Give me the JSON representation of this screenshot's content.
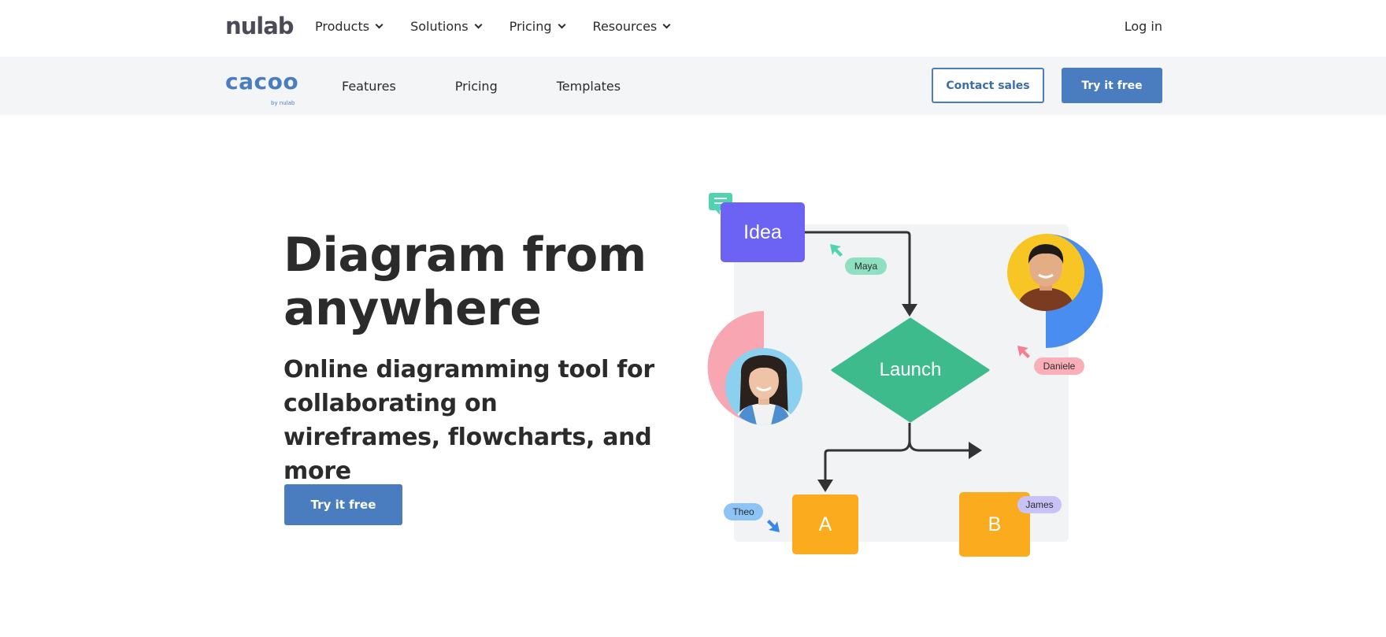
{
  "topnav": {
    "logo": "nulab",
    "menu": [
      {
        "label": "Products"
      },
      {
        "label": "Solutions"
      },
      {
        "label": "Pricing"
      },
      {
        "label": "Resources"
      }
    ],
    "login": "Log in"
  },
  "product_bar": {
    "logo": "cacoo",
    "logo_byline": "by nulab",
    "menu": [
      {
        "label": "Features"
      },
      {
        "label": "Pricing"
      },
      {
        "label": "Templates"
      }
    ],
    "contact_sales": "Contact sales",
    "try_free": "Try it free"
  },
  "hero": {
    "title": "Diagram from anywhere",
    "subtitle": "Online diagramming tool for collaborating on wireframes, flowcharts, and more",
    "cta": "Try it free"
  },
  "illustration": {
    "nodes": {
      "idea": "Idea",
      "launch": "Launch",
      "a": "A",
      "b": "B"
    },
    "collaborators": {
      "maya": "Maya",
      "daniele": "Daniele",
      "theo": "Theo",
      "james": "James"
    },
    "colors": {
      "idea": "#6c63f5",
      "launch": "#3dbb8c",
      "box": "#fbab1e",
      "brand": "#4a7cc0"
    },
    "icons": [
      "comment-icon",
      "cursor-arrow-icon"
    ]
  }
}
